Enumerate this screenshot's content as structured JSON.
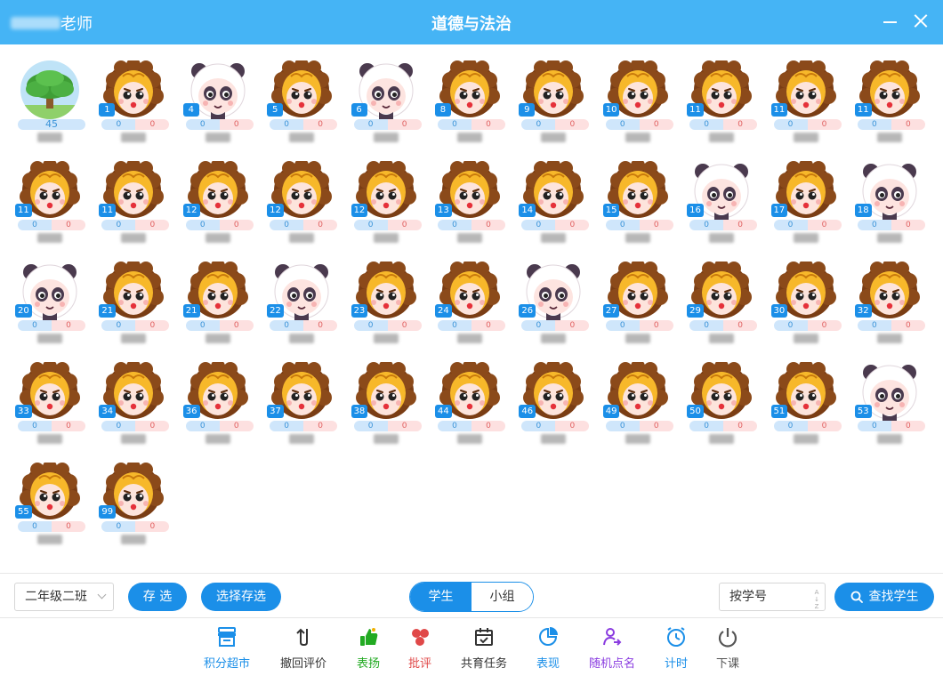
{
  "window": {
    "teacher_suffix": "老师",
    "title": "道德与法治"
  },
  "teacher_card": {
    "score": "45"
  },
  "students": [
    {
      "num": "1",
      "type": "lion",
      "pos": "0",
      "neg": "0"
    },
    {
      "num": "4",
      "type": "panda",
      "pos": "0",
      "neg": "0"
    },
    {
      "num": "5",
      "type": "lion",
      "pos": "0",
      "neg": "0"
    },
    {
      "num": "6",
      "type": "panda",
      "pos": "0",
      "neg": "0"
    },
    {
      "num": "8",
      "type": "lion",
      "pos": "0",
      "neg": "0"
    },
    {
      "num": "9",
      "type": "lion",
      "pos": "0",
      "neg": "0"
    },
    {
      "num": "10",
      "type": "lion",
      "pos": "0",
      "neg": "0"
    },
    {
      "num": "11",
      "type": "lion",
      "pos": "0",
      "neg": "0"
    },
    {
      "num": "11",
      "type": "lion",
      "pos": "0",
      "neg": "0"
    },
    {
      "num": "11",
      "type": "lion",
      "pos": "0",
      "neg": "0"
    },
    {
      "num": "11",
      "type": "lion",
      "pos": "0",
      "neg": "0"
    },
    {
      "num": "11",
      "type": "lion",
      "pos": "0",
      "neg": "0"
    },
    {
      "num": "12",
      "type": "lion",
      "pos": "0",
      "neg": "0"
    },
    {
      "num": "12",
      "type": "lion",
      "pos": "0",
      "neg": "0"
    },
    {
      "num": "12",
      "type": "lion",
      "pos": "0",
      "neg": "0"
    },
    {
      "num": "13",
      "type": "lion",
      "pos": "0",
      "neg": "0"
    },
    {
      "num": "14",
      "type": "lion",
      "pos": "0",
      "neg": "0"
    },
    {
      "num": "15",
      "type": "lion",
      "pos": "0",
      "neg": "0"
    },
    {
      "num": "16",
      "type": "panda",
      "pos": "0",
      "neg": "0"
    },
    {
      "num": "17",
      "type": "lion",
      "pos": "0",
      "neg": "0"
    },
    {
      "num": "18",
      "type": "panda",
      "pos": "0",
      "neg": "0"
    },
    {
      "num": "20",
      "type": "panda",
      "pos": "0",
      "neg": "0"
    },
    {
      "num": "21",
      "type": "lion",
      "pos": "0",
      "neg": "0"
    },
    {
      "num": "21",
      "type": "lion",
      "pos": "0",
      "neg": "0"
    },
    {
      "num": "22",
      "type": "panda",
      "pos": "0",
      "neg": "0"
    },
    {
      "num": "23",
      "type": "lion",
      "pos": "0",
      "neg": "0"
    },
    {
      "num": "24",
      "type": "lion",
      "pos": "0",
      "neg": "0"
    },
    {
      "num": "26",
      "type": "panda",
      "pos": "0",
      "neg": "0"
    },
    {
      "num": "27",
      "type": "lion",
      "pos": "0",
      "neg": "0"
    },
    {
      "num": "29",
      "type": "lion",
      "pos": "0",
      "neg": "0"
    },
    {
      "num": "30",
      "type": "lion",
      "pos": "0",
      "neg": "0"
    },
    {
      "num": "32",
      "type": "lion",
      "pos": "0",
      "neg": "0"
    },
    {
      "num": "33",
      "type": "lion",
      "pos": "0",
      "neg": "0"
    },
    {
      "num": "34",
      "type": "lion",
      "pos": "0",
      "neg": "0"
    },
    {
      "num": "36",
      "type": "lion",
      "pos": "0",
      "neg": "0"
    },
    {
      "num": "37",
      "type": "lion",
      "pos": "0",
      "neg": "0"
    },
    {
      "num": "38",
      "type": "lion",
      "pos": "0",
      "neg": "0"
    },
    {
      "num": "44",
      "type": "lion",
      "pos": "0",
      "neg": "0"
    },
    {
      "num": "46",
      "type": "lion",
      "pos": "0",
      "neg": "0"
    },
    {
      "num": "49",
      "type": "lion",
      "pos": "0",
      "neg": "0"
    },
    {
      "num": "50",
      "type": "lion",
      "pos": "0",
      "neg": "0"
    },
    {
      "num": "51",
      "type": "lion",
      "pos": "0",
      "neg": "0"
    },
    {
      "num": "53",
      "type": "panda",
      "pos": "0",
      "neg": "0"
    },
    {
      "num": "55",
      "type": "lion",
      "pos": "0",
      "neg": "0"
    },
    {
      "num": "99",
      "type": "lion",
      "pos": "0",
      "neg": "0"
    }
  ],
  "controls": {
    "class_select": "二年级二班",
    "save_label": "存 选",
    "select_saved_label": "选择存选",
    "mode_tabs": [
      "学生",
      "小组"
    ],
    "active_mode": "学生",
    "sort_select": "按学号",
    "find_student_label": "查找学生"
  },
  "toolbar": [
    {
      "label": "积分超市",
      "icon": "store-icon",
      "color": "#1b8fe8"
    },
    {
      "label": "撤回评价",
      "icon": "undo-icon",
      "color": "#333333"
    },
    {
      "label": "表扬",
      "icon": "thumbs-up-icon",
      "color": "#22aa22"
    },
    {
      "label": "批评",
      "icon": "criticize-icon",
      "color": "#e04848"
    },
    {
      "label": "共育任务",
      "icon": "calendar-task-icon",
      "color": "#333333"
    },
    {
      "label": "表现",
      "icon": "pie-chart-icon",
      "color": "#1b8fe8"
    },
    {
      "label": "随机点名",
      "icon": "random-pick-icon",
      "color": "#8a3ce0"
    },
    {
      "label": "计时",
      "icon": "timer-icon",
      "color": "#1b8fe8"
    },
    {
      "label": "下课",
      "icon": "power-icon",
      "color": "#555555"
    }
  ]
}
